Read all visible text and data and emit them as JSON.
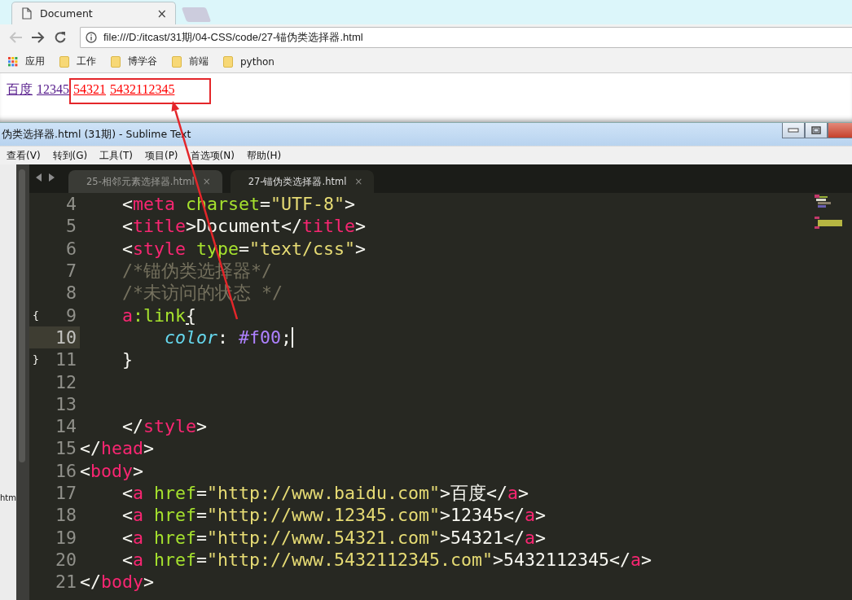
{
  "browser": {
    "tab": {
      "title": "Document",
      "close": "×"
    },
    "address": {
      "value": "file:///D:/itcast/31期/04-CSS/code/27-锚伪类选择器.html"
    },
    "bookmarks": [
      {
        "label": "应用",
        "kind": "apps"
      },
      {
        "label": "工作",
        "kind": "folder"
      },
      {
        "label": "博学谷",
        "kind": "folder"
      },
      {
        "label": "前端",
        "kind": "folder"
      },
      {
        "label": "python",
        "kind": "folder"
      }
    ],
    "page_links": [
      {
        "text": "百度",
        "visited": true
      },
      {
        "text": "12345",
        "visited": true
      },
      {
        "text": "54321",
        "visited": false
      },
      {
        "text": "5432112345",
        "visited": false
      }
    ]
  },
  "editor": {
    "window_title": "伪类选择器.html (31期) - Sublime Text",
    "menu": [
      "查看(V)",
      "转到(G)",
      "工具(T)",
      "项目(P)",
      "首选项(N)",
      "帮助(H)"
    ],
    "sidebar_text": "htm",
    "tabs": [
      {
        "label": "25-相邻元素选择器.html",
        "close": "×",
        "selected": false
      },
      {
        "label": "27-锚伪类选择器.html",
        "close": "×",
        "selected": true
      }
    ],
    "lines": [
      {
        "number": "4",
        "current": false,
        "tokens": [
          {
            "text": "    <",
            "kind": "punct"
          },
          {
            "text": "meta",
            "kind": "tag"
          },
          {
            "text": " charset",
            "kind": "attr"
          },
          {
            "text": "=",
            "kind": "punct"
          },
          {
            "text": "\"UTF-8\"",
            "kind": "string"
          },
          {
            "text": ">",
            "kind": "punct"
          }
        ]
      },
      {
        "number": "5",
        "current": false,
        "tokens": [
          {
            "text": "    <",
            "kind": "punct"
          },
          {
            "text": "title",
            "kind": "tag"
          },
          {
            "text": ">Document</",
            "kind": "punct"
          },
          {
            "text": "title",
            "kind": "tag"
          },
          {
            "text": ">",
            "kind": "punct"
          }
        ]
      },
      {
        "number": "6",
        "current": false,
        "tokens": [
          {
            "text": "    <",
            "kind": "punct"
          },
          {
            "text": "style",
            "kind": "tag"
          },
          {
            "text": " type",
            "kind": "attr"
          },
          {
            "text": "=",
            "kind": "punct"
          },
          {
            "text": "\"text/css\"",
            "kind": "string"
          },
          {
            "text": ">",
            "kind": "punct"
          }
        ]
      },
      {
        "number": "7",
        "current": false,
        "tokens": [
          {
            "text": "    /*锚伪类选择器*/",
            "kind": "comment"
          }
        ]
      },
      {
        "number": "8",
        "current": false,
        "tokens": [
          {
            "text": "    /*未访问的状态 */",
            "kind": "comment"
          }
        ]
      },
      {
        "number": "9",
        "current": false,
        "fold": "{",
        "tokens": [
          {
            "text": "    a",
            "kind": "tag"
          },
          {
            "text": ":link",
            "kind": "attr"
          },
          {
            "text": "{",
            "kind": "brace"
          }
        ]
      },
      {
        "number": "10",
        "current": true,
        "tokens": [
          {
            "text": "        color",
            "kind": "prop"
          },
          {
            "text": ": ",
            "kind": "punct"
          },
          {
            "text": "#f00",
            "kind": "value"
          },
          {
            "text": ";",
            "kind": "punct"
          }
        ]
      },
      {
        "number": "11",
        "current": false,
        "fold": "}",
        "tokens": [
          {
            "text": "    }",
            "kind": "punct"
          }
        ]
      },
      {
        "number": "12",
        "current": false
      },
      {
        "number": "13",
        "current": false
      },
      {
        "number": "14",
        "current": false,
        "tokens": [
          {
            "text": "    </",
            "kind": "punct"
          },
          {
            "text": "style",
            "kind": "tag"
          },
          {
            "text": ">",
            "kind": "punct"
          }
        ]
      },
      {
        "number": "15",
        "current": false,
        "tokens": [
          {
            "text": "</",
            "kind": "punct"
          },
          {
            "text": "head",
            "kind": "tag"
          },
          {
            "text": ">",
            "kind": "punct"
          }
        ]
      },
      {
        "number": "16",
        "current": false,
        "tokens": [
          {
            "text": "<",
            "kind": "punct"
          },
          {
            "text": "body",
            "kind": "tag"
          },
          {
            "text": ">",
            "kind": "punct"
          }
        ]
      },
      {
        "number": "17",
        "current": false,
        "tokens": [
          {
            "text": "    <",
            "kind": "punct"
          },
          {
            "text": "a",
            "kind": "tag"
          },
          {
            "text": " href",
            "kind": "attr"
          },
          {
            "text": "=",
            "kind": "punct"
          },
          {
            "text": "\"http://www.baidu.com\"",
            "kind": "string"
          },
          {
            "text": ">百度</",
            "kind": "punct"
          },
          {
            "text": "a",
            "kind": "tag"
          },
          {
            "text": ">",
            "kind": "punct"
          }
        ]
      },
      {
        "number": "18",
        "current": false,
        "tokens": [
          {
            "text": "    <",
            "kind": "punct"
          },
          {
            "text": "a",
            "kind": "tag"
          },
          {
            "text": " href",
            "kind": "attr"
          },
          {
            "text": "=",
            "kind": "punct"
          },
          {
            "text": "\"http://www.12345.com\"",
            "kind": "string"
          },
          {
            "text": ">12345</",
            "kind": "punct"
          },
          {
            "text": "a",
            "kind": "tag"
          },
          {
            "text": ">",
            "kind": "punct"
          }
        ]
      },
      {
        "number": "19",
        "current": false,
        "tokens": [
          {
            "text": "    <",
            "kind": "punct"
          },
          {
            "text": "a",
            "kind": "tag"
          },
          {
            "text": " href",
            "kind": "attr"
          },
          {
            "text": "=",
            "kind": "punct"
          },
          {
            "text": "\"http://www.54321.com\"",
            "kind": "string"
          },
          {
            "text": ">54321</",
            "kind": "punct"
          },
          {
            "text": "a",
            "kind": "tag"
          },
          {
            "text": ">",
            "kind": "punct"
          }
        ]
      },
      {
        "number": "20",
        "current": false,
        "tokens": [
          {
            "text": "    <",
            "kind": "punct"
          },
          {
            "text": "a",
            "kind": "tag"
          },
          {
            "text": " href",
            "kind": "attr"
          },
          {
            "text": "=",
            "kind": "punct"
          },
          {
            "text": "\"http://www.5432112345.com\"",
            "kind": "string"
          },
          {
            "text": ">5432112345</",
            "kind": "punct"
          },
          {
            "text": "a",
            "kind": "tag"
          },
          {
            "text": ">",
            "kind": "punct"
          }
        ]
      },
      {
        "number": "21",
        "current": false,
        "tokens": [
          {
            "text": "</",
            "kind": "punct"
          },
          {
            "text": "body",
            "kind": "tag"
          },
          {
            "text": ">",
            "kind": "punct"
          }
        ]
      }
    ]
  }
}
